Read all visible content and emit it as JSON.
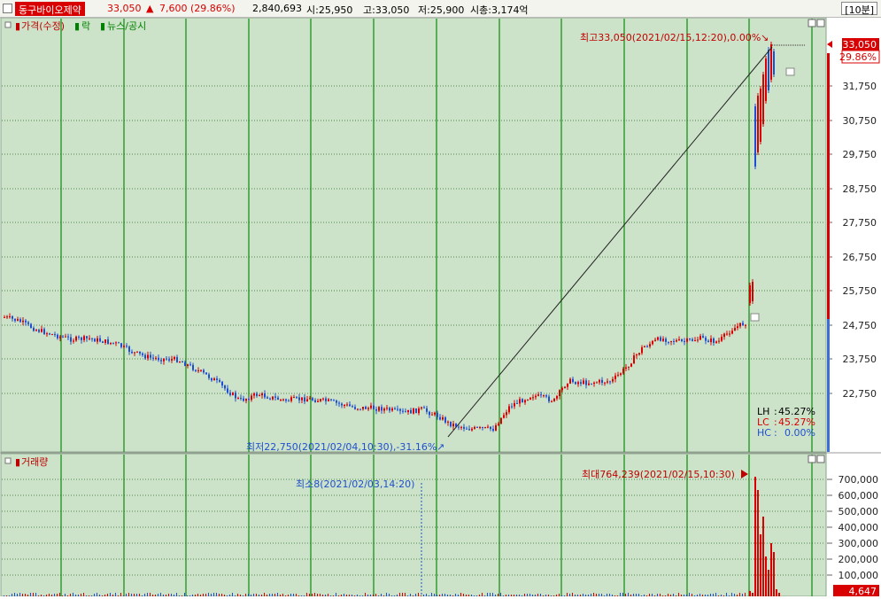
{
  "header": {
    "stock_name": "동구바이오제약",
    "price": "33,050",
    "change_arrow": "▲",
    "change": "7,600 (29.86%)",
    "volume": "2,840,693",
    "open": "시:25,950",
    "high": "고:33,050",
    "low": "저:25,900",
    "market_cap": "시총:3,174억",
    "period_button": "[10분]"
  },
  "price_panel": {
    "legend": [
      {
        "label": "가격(수정)",
        "color": "#c00000"
      },
      {
        "label": "락",
        "color": "#008000"
      },
      {
        "label": "뉴스/공시",
        "color": "#008000"
      }
    ],
    "y_ticks": [
      "33,050",
      "31,750",
      "30,750",
      "29,750",
      "28,750",
      "27,750",
      "26,750",
      "25,750",
      "24,750",
      "23,750",
      "22,750"
    ],
    "current_price": "33,050",
    "current_pct": "29.86%",
    "max_label": "최고33,050(2021/02/15,12:20),0.00%",
    "min_label": "최저22,750(2021/02/04,10:30),-31.16%",
    "stats": [
      {
        "key": "LH",
        "value": "45.27%",
        "color": "#000000"
      },
      {
        "key": "LC",
        "value": "45.27%",
        "color": "#d80000"
      },
      {
        "key": "HC",
        "value": "0.00%",
        "color": "#1f4fd0"
      }
    ]
  },
  "volume_panel": {
    "legend": "거래량",
    "y_ticks": [
      "700,000",
      "600,000",
      "500,000",
      "400,000",
      "300,000",
      "200,000",
      "100,000"
    ],
    "current_volume": "4,647",
    "max_label": "최대764,239(2021/02/15,10:30)",
    "min_label": "최소8(2021/02/03,14:20)"
  },
  "colors": {
    "up": "#d80000",
    "down": "#1f4fd0",
    "chart_bg": "#cde3c9",
    "grid": "#008800",
    "axis_bg": "#ffffff"
  }
}
